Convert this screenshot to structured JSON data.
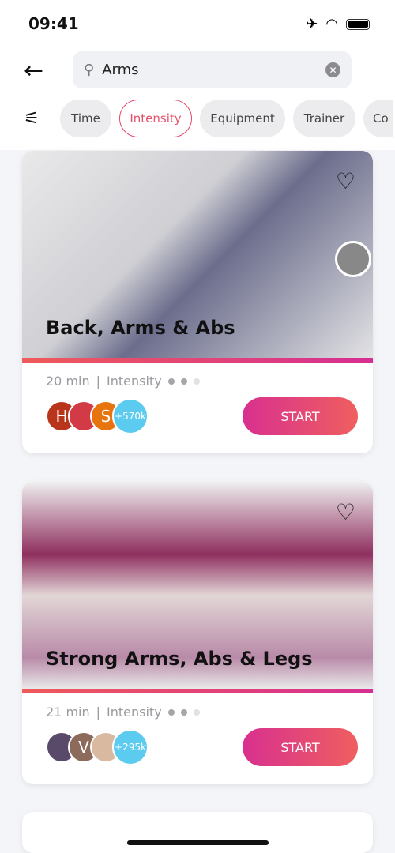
{
  "status": {
    "time": "09:41"
  },
  "search": {
    "value": "Arms"
  },
  "filters": [
    "Time",
    "Intensity",
    "Equipment",
    "Trainer",
    "Co"
  ],
  "active_filter": "Intensity",
  "colors": {
    "accent": "#e5536b",
    "gradient_start": "#d8308f",
    "gradient_end": "#ef5f5f",
    "count_badge": "#5ccbf0"
  },
  "cards": [
    {
      "title": "Back, Arms & Abs",
      "duration": "20 min",
      "intensity_label": "Intensity",
      "intensity_level": 2,
      "intensity_max": 3,
      "avatars": [
        "H",
        "",
        "S"
      ],
      "count": "+570k",
      "start": "START"
    },
    {
      "title": "Strong Arms, Abs & Legs",
      "duration": "21 min",
      "intensity_label": "Intensity",
      "intensity_level": 2,
      "intensity_max": 3,
      "avatars": [
        "",
        "V",
        ""
      ],
      "count": "+295k",
      "start": "START"
    }
  ]
}
